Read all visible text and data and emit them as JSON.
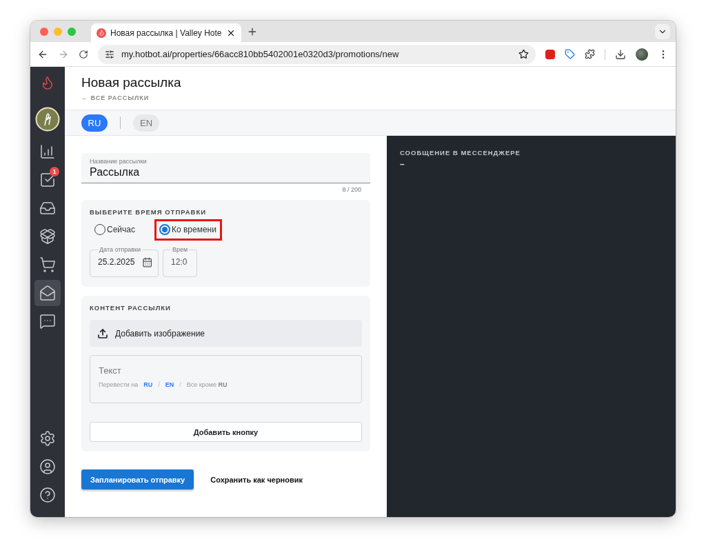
{
  "browser": {
    "tab_title": "Новая рассылка | Valley Hote",
    "address": "my.hotbot.ai/properties/66acc810bb5402001e0320d3/promotions/new"
  },
  "sidebar": {
    "items": [
      {
        "kind": "chart",
        "selected": false
      },
      {
        "kind": "tasks",
        "selected": false,
        "badge": "1"
      },
      {
        "kind": "inbox",
        "selected": false
      },
      {
        "kind": "reviews",
        "selected": false
      },
      {
        "kind": "cart",
        "selected": false
      },
      {
        "kind": "mail",
        "selected": true
      },
      {
        "kind": "chat",
        "selected": false
      }
    ],
    "bottom_items": [
      {
        "kind": "settings"
      },
      {
        "kind": "profile"
      },
      {
        "kind": "help"
      }
    ]
  },
  "header": {
    "title": "Новая рассылка",
    "back_link": "← ВСЕ РАССЫЛКИ"
  },
  "languages": [
    {
      "label": "RU",
      "selected": true
    },
    {
      "label": "EN",
      "selected": false
    }
  ],
  "name_field": {
    "label": "Название рассылки",
    "value": "Рассылка",
    "counter": "8 / 200"
  },
  "schedule": {
    "title": "ВЫБЕРИТЕ ВРЕМЯ ОТПРАВКИ",
    "options": [
      {
        "label": "Сейчас",
        "selected": false,
        "highlighted": false
      },
      {
        "label": "Ко времени",
        "selected": true,
        "highlighted": true
      }
    ],
    "date_field": {
      "label": "Дата отправки",
      "value": "25.2.2025"
    },
    "time_field": {
      "label": "Врем",
      "value": "12:0"
    }
  },
  "content": {
    "title": "КОНТЕНТ РАССЫЛКИ",
    "add_image": "Добавить изображение",
    "text_placeholder": "Текст",
    "translate": {
      "label": "Перевести на",
      "separators": [
        "/",
        "/"
      ],
      "targets": [
        {
          "label": "RU",
          "kind": "language"
        },
        {
          "label": "EN",
          "kind": "language"
        },
        {
          "label": "Все кроме **RU**",
          "kind": "all"
        }
      ]
    },
    "add_button": "Добавить кнопку"
  },
  "actions": {
    "primary": "Запланировать отправку",
    "secondary": "Сохранить как черновик"
  },
  "preview": {
    "title": "СООБЩЕНИЕ В МЕССЕНДЖЕРЕ",
    "body": "–"
  }
}
